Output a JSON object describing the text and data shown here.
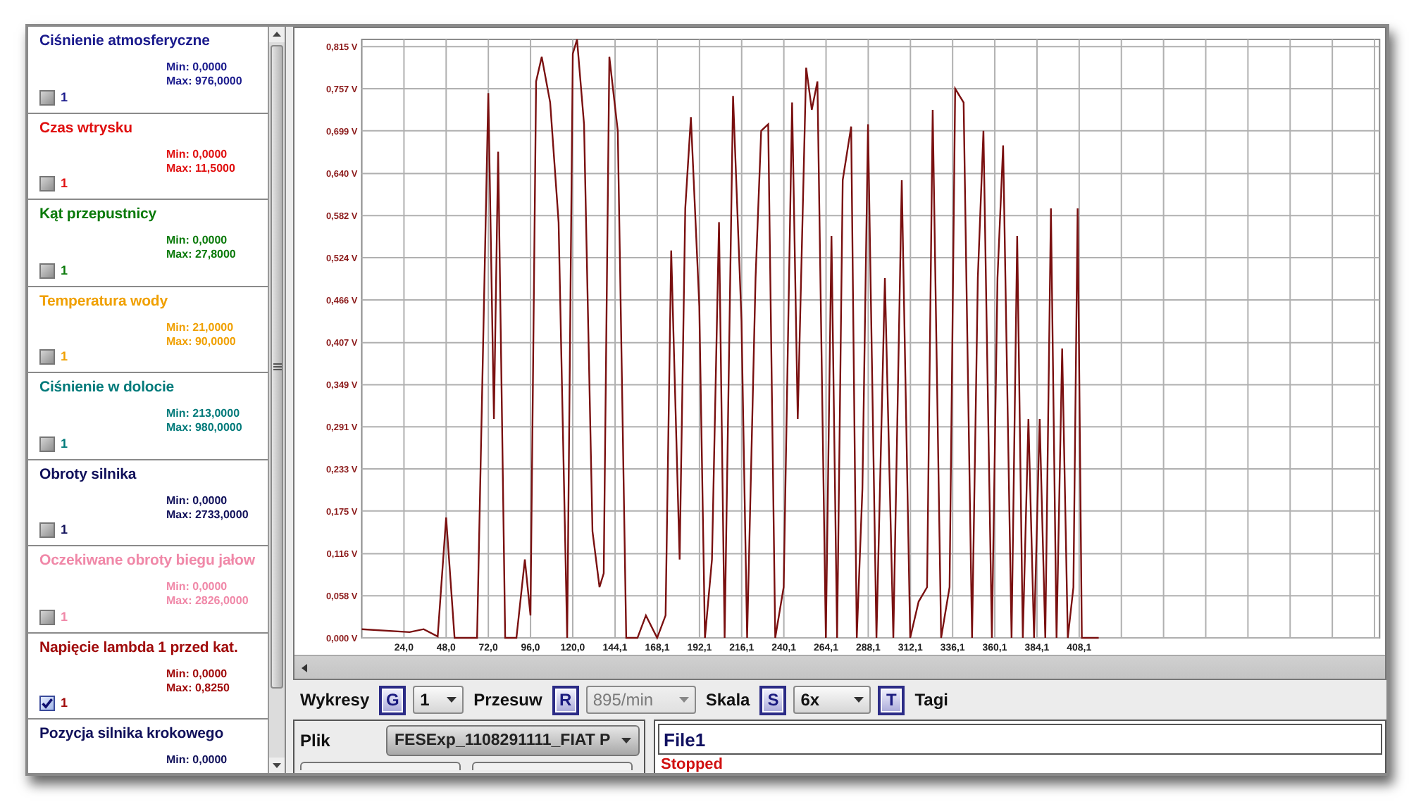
{
  "channels": [
    {
      "name": "Ciśnienie atmosferyczne",
      "color": "#1a1a8c",
      "min": "Min: 0,0000",
      "max": "Max: 976,0000",
      "count": "1",
      "checked": false
    },
    {
      "name": "Czas wtrysku",
      "color": "#e01010",
      "min": "Min: 0,0000",
      "max": "Max: 11,5000",
      "count": "1",
      "checked": false
    },
    {
      "name": "Kąt przepustnicy",
      "color": "#0a7a0a",
      "min": "Min: 0,0000",
      "max": "Max: 27,8000",
      "count": "1",
      "checked": false
    },
    {
      "name": "Temperatura wody",
      "color": "#f0a000",
      "min": "Min: 21,0000",
      "max": "Max: 90,0000",
      "count": "1",
      "checked": false
    },
    {
      "name": "Ciśnienie w dolocie",
      "color": "#007a7a",
      "min": "Min: 213,0000",
      "max": "Max: 980,0000",
      "count": "1",
      "checked": false
    },
    {
      "name": "Obroty silnika",
      "color": "#10105a",
      "min": "Min: 0,0000",
      "max": "Max: 2733,0000",
      "count": "1",
      "checked": false
    },
    {
      "name": "Oczekiwane obroty biegu jałow",
      "color": "#f088a8",
      "min": "Min: 0,0000",
      "max": "Max: 2826,0000",
      "count": "1",
      "checked": false
    },
    {
      "name": "Napięcie lambda 1 przed kat.",
      "color": "#a00a0a",
      "min": "Min: 0,0000",
      "max": "Max: 0,8250",
      "count": "1",
      "checked": true
    },
    {
      "name": "Pozycja silnika krokowego",
      "color": "#10105a",
      "min": "Min: 0,0000"
    }
  ],
  "chart": {
    "chart_data": {
      "type": "line",
      "grid": true,
      "x": [
        0,
        27.2,
        35.2,
        43.2,
        48,
        52.8,
        65.6,
        72,
        75.2,
        77.6,
        81.6,
        88,
        92.8,
        96,
        99.2,
        102.4,
        107.2,
        112,
        116.8,
        120,
        122.4,
        126.4,
        131.2,
        135.2,
        137.6,
        140.8,
        145.6,
        150.4,
        156.8,
        161.6,
        168,
        172.8,
        176,
        180.8,
        184,
        187.2,
        192,
        195.2,
        199.2,
        203.2,
        206.4,
        211.2,
        216,
        219.2,
        224,
        227.2,
        231.2,
        235.2,
        240,
        244.8,
        248,
        252.8,
        256,
        259.2,
        264,
        267.2,
        270.4,
        273.6,
        278.4,
        281.6,
        284.8,
        288,
        292.8,
        297.6,
        302.4,
        307.2,
        312,
        316.8,
        321.6,
        324.8,
        329.6,
        334.4,
        337.6,
        342.4,
        347.2,
        350.4,
        353.6,
        358.4,
        361.6,
        364.8,
        369.6,
        372.8,
        376,
        379.2,
        382.4,
        385.6,
        388.8,
        392,
        395.2,
        398.4,
        401.6,
        404.8,
        407.2,
        409.6,
        419.2
      ],
      "series": [
        {
          "color": "#7a1010",
          "values": [
            0.012,
            0.008,
            0.012,
            0.002,
            0.166,
            0,
            0,
            0.751,
            0.302,
            0.67,
            0,
            0,
            0.108,
            0.031,
            0.767,
            0.801,
            0.738,
            0.573,
            0,
            0.805,
            0.825,
            0.708,
            0.147,
            0.07,
            0.089,
            0.801,
            0.699,
            0,
            0,
            0.031,
            0,
            0.031,
            0.534,
            0.108,
            0.592,
            0.718,
            0.457,
            0,
            0.108,
            0.573,
            0,
            0.747,
            0.437,
            0,
            0.496,
            0.699,
            0.708,
            0,
            0.07,
            0.738,
            0.302,
            0.786,
            0.728,
            0.767,
            0,
            0.554,
            0,
            0.631,
            0.705,
            0,
            0.205,
            0.708,
            0,
            0.496,
            0,
            0.631,
            0,
            0.05,
            0.07,
            0.728,
            0,
            0.07,
            0.757,
            0.738,
            0,
            0.496,
            0.699,
            0,
            0.496,
            0.679,
            0,
            0.554,
            0,
            0.302,
            0,
            0.302,
            0,
            0.592,
            0,
            0.399,
            0,
            0.07,
            0.592,
            0,
            0
          ]
        }
      ],
      "xlim": [
        0,
        579
      ],
      "ylim": [
        0,
        0.825
      ],
      "xticks": [
        {
          "value": 24,
          "label": "24,0"
        },
        {
          "value": 48,
          "label": "48,0"
        },
        {
          "value": 72,
          "label": "72,0"
        },
        {
          "value": 96,
          "label": "96,0"
        },
        {
          "value": 120,
          "label": "120,0"
        },
        {
          "value": 144.1,
          "label": "144,1"
        },
        {
          "value": 168.1,
          "label": "168,1"
        },
        {
          "value": 192.1,
          "label": "192,1"
        },
        {
          "value": 216.1,
          "label": "216,1"
        },
        {
          "value": 240.1,
          "label": "240,1"
        },
        {
          "value": 264.1,
          "label": "264,1"
        },
        {
          "value": 288.1,
          "label": "288,1"
        },
        {
          "value": 312.1,
          "label": "312,1"
        },
        {
          "value": 336.1,
          "label": "336,1"
        },
        {
          "value": 360.1,
          "label": "360,1"
        },
        {
          "value": 384.1,
          "label": "384,1"
        },
        {
          "value": 408.1,
          "label": "408,1"
        }
      ],
      "yticks": [
        {
          "value": 0,
          "label": "0,000 V"
        },
        {
          "value": 0.058,
          "label": "0,058 V"
        },
        {
          "value": 0.116,
          "label": "0,116 V"
        },
        {
          "value": 0.175,
          "label": "0,175 V"
        },
        {
          "value": 0.233,
          "label": "0,233 V"
        },
        {
          "value": 0.291,
          "label": "0,291 V"
        },
        {
          "value": 0.349,
          "label": "0,349 V"
        },
        {
          "value": 0.407,
          "label": "0,407 V"
        },
        {
          "value": 0.466,
          "label": "0,466 V"
        },
        {
          "value": 0.524,
          "label": "0,524 V"
        },
        {
          "value": 0.582,
          "label": "0,582 V"
        },
        {
          "value": 0.64,
          "label": "0,640 V"
        },
        {
          "value": 0.699,
          "label": "0,699 V"
        },
        {
          "value": 0.757,
          "label": "0,757 V"
        },
        {
          "value": 0.815,
          "label": "0,815 V"
        }
      ]
    }
  },
  "toolbar": {
    "items": [
      {
        "kind": "label",
        "text": "Wykresy"
      },
      {
        "kind": "key",
        "text": "G"
      },
      {
        "kind": "dropdown",
        "value": "1",
        "disabled": false
      },
      {
        "kind": "label",
        "text": "Przesuw"
      },
      {
        "kind": "key",
        "text": "R"
      },
      {
        "kind": "dropdown",
        "value": "895/min",
        "disabled": true
      },
      {
        "kind": "label",
        "text": "Skala"
      },
      {
        "kind": "key",
        "text": "S"
      },
      {
        "kind": "dropdown",
        "value": "6x",
        "disabled": false
      },
      {
        "kind": "key",
        "text": "T"
      },
      {
        "kind": "label",
        "text": "Tagi"
      }
    ]
  },
  "file_panel": {
    "label": "Plik",
    "file": "FESExp_1108291111_FIAT P"
  },
  "status_panel": {
    "name": "File1",
    "state": "Stopped"
  }
}
